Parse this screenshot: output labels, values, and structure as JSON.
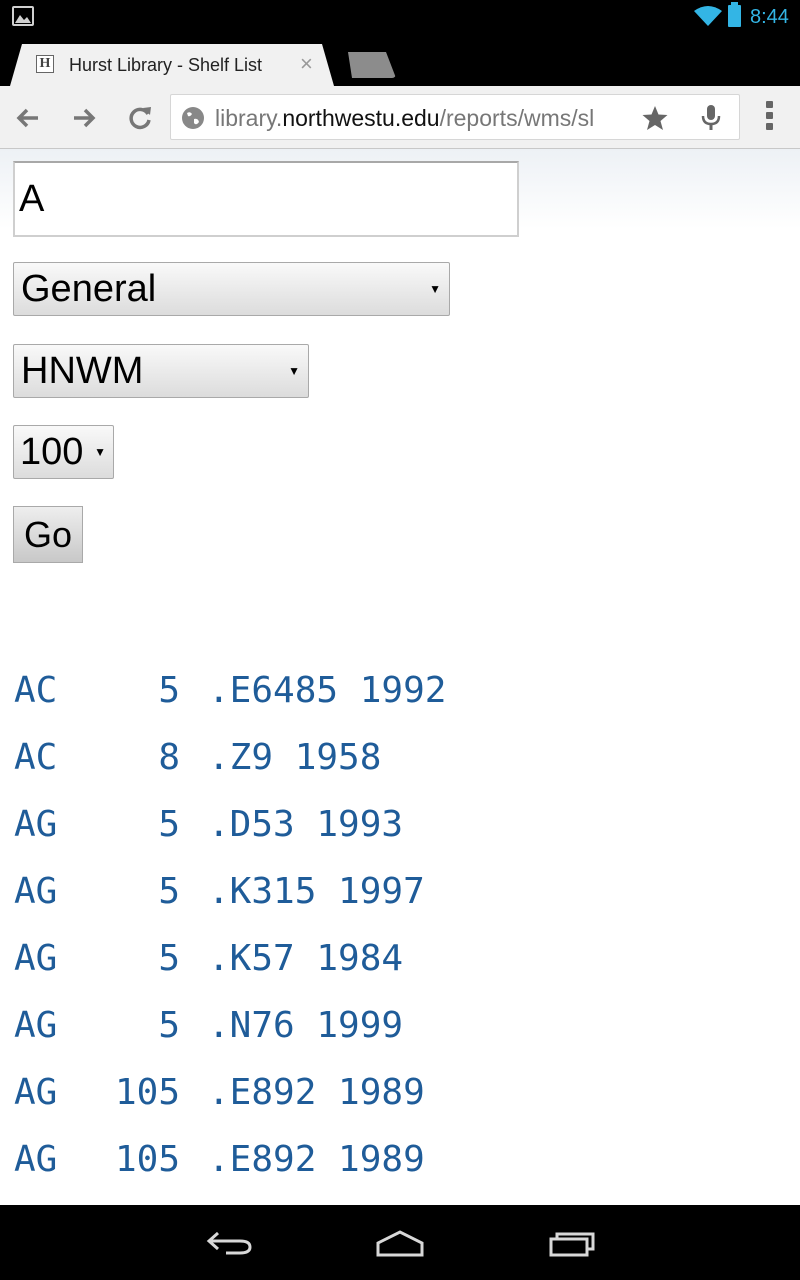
{
  "status_bar": {
    "time": "8:44",
    "icons": [
      "image-notification-icon",
      "wifi-icon",
      "battery-icon"
    ],
    "accent_color": "#33b5e5"
  },
  "browser": {
    "tab": {
      "favicon_letter": "H",
      "title": "Hurst Library - Shelf List",
      "close_glyph": "×"
    },
    "url": {
      "prefix": "library.",
      "domain": "northwestu.edu",
      "path": "/reports/wms/sl"
    }
  },
  "form": {
    "query_value": "A",
    "collection_select": "General",
    "location_select": "HNWM",
    "limit_select": "100",
    "go_label": "Go"
  },
  "results": [
    {
      "class": "AC",
      "number": "5",
      "cutter": ".E6485 1992"
    },
    {
      "class": "AC",
      "number": "8",
      "cutter": ".Z9 1958"
    },
    {
      "class": "AG",
      "number": "5",
      "cutter": ".D53 1993"
    },
    {
      "class": "AG",
      "number": "5",
      "cutter": ".K315 1997"
    },
    {
      "class": "AG",
      "number": "5",
      "cutter": ".K57 1984"
    },
    {
      "class": "AG",
      "number": "5",
      "cutter": ".N76 1999"
    },
    {
      "class": "AG",
      "number": "105",
      "cutter": ".E892 1989"
    },
    {
      "class": "AG",
      "number": "105",
      "cutter": ".E892 1989"
    }
  ],
  "colors": {
    "result_text": "#1f5c99"
  }
}
